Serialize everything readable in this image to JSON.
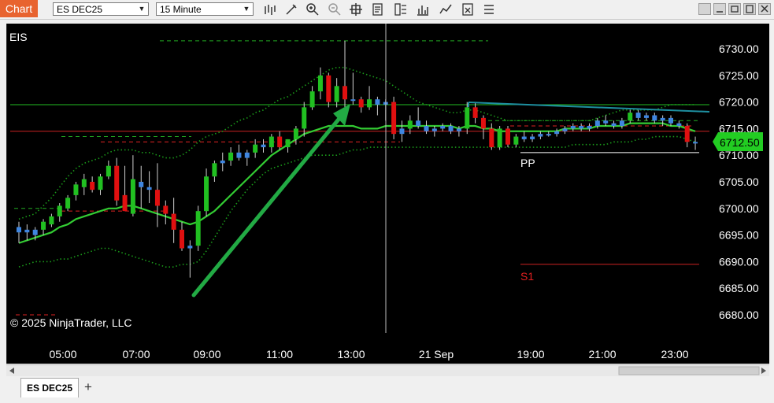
{
  "toolbar": {
    "chart_label": "Chart",
    "instrument_value": "ES DEC25",
    "interval_value": "15 Minute"
  },
  "chart": {
    "panel_label": "EIS",
    "copyright": "© 2025 NinjaTrader, LLC",
    "current_price": "6712.50",
    "pivot_labels": [
      "PP",
      "S1"
    ],
    "y_ticks": [
      "6730.00",
      "6725.00",
      "6720.00",
      "6715.00",
      "6710.00",
      "6705.00",
      "6700.00",
      "6695.00",
      "6690.00",
      "6685.00",
      "6680.00"
    ],
    "x_ticks": [
      "05:00",
      "07:00",
      "09:00",
      "11:00",
      "13:00",
      "21 Sep",
      "19:00",
      "21:00",
      "23:00"
    ],
    "colors": {
      "up": "#21c021",
      "down": "#e01010",
      "flat_up": "#3f86e0",
      "sma": "#33cc33",
      "band": "#1a9a1a",
      "price_tag": "#22cc22",
      "trend_arrow": "#22aa44"
    }
  },
  "chart_data": {
    "type": "candlestick",
    "y_range": [
      6678,
      6734
    ],
    "candles": [
      [
        6695.5,
        6697.5,
        6693.5,
        6696.5
      ],
      [
        6696.0,
        6697.0,
        6694.0,
        6695.5
      ],
      [
        6695.0,
        6696.5,
        6694.0,
        6696.0
      ],
      [
        6696.0,
        6698.0,
        6695.0,
        6697.5
      ],
      [
        6697.0,
        6699.0,
        6696.5,
        6698.5
      ],
      [
        6698.5,
        6701.0,
        6697.5,
        6700.5
      ],
      [
        6700.0,
        6702.5,
        6699.5,
        6702.0
      ],
      [
        6702.5,
        6705.0,
        6701.5,
        6704.5
      ],
      [
        6704.0,
        6706.5,
        6702.5,
        6705.5
      ],
      [
        6705.0,
        6706.0,
        6703.0,
        6703.5
      ],
      [
        6703.5,
        6706.5,
        6702.5,
        6706.0
      ],
      [
        6706.0,
        6709.0,
        6705.5,
        6708.0
      ],
      [
        6708.0,
        6709.5,
        6700.5,
        6701.5
      ],
      [
        6702.5,
        6708.0,
        6699.5,
        6699.5
      ],
      [
        6699.0,
        6710.0,
        6698.5,
        6705.5
      ],
      [
        6705.0,
        6708.0,
        6700.0,
        6704.0
      ],
      [
        6704.0,
        6707.0,
        6701.0,
        6703.5
      ],
      [
        6703.5,
        6708.5,
        6696.5,
        6700.5
      ],
      [
        6700.5,
        6701.5,
        6697.0,
        6699.0
      ],
      [
        6699.0,
        6702.0,
        6693.5,
        6696.0
      ],
      [
        6696.0,
        6697.5,
        6692.0,
        6692.5
      ],
      [
        6692.5,
        6694.0,
        6687.0,
        6693.0
      ],
      [
        6693.0,
        6700.5,
        6692.0,
        6699.5
      ],
      [
        6699.5,
        6707.5,
        6698.5,
        6706.0
      ],
      [
        6706.0,
        6709.0,
        6705.0,
        6708.5
      ],
      [
        6708.5,
        6710.5,
        6707.0,
        6709.0
      ],
      [
        6709.0,
        6711.5,
        6708.0,
        6710.5
      ],
      [
        6710.5,
        6712.0,
        6709.0,
        6709.5
      ],
      [
        6709.5,
        6711.0,
        6708.0,
        6710.5
      ],
      [
        6710.5,
        6713.0,
        6709.5,
        6712.0
      ],
      [
        6712.0,
        6713.0,
        6710.5,
        6711.5
      ],
      [
        6711.5,
        6714.0,
        6710.5,
        6713.5
      ],
      [
        6713.5,
        6714.5,
        6711.0,
        6711.5
      ],
      [
        6711.5,
        6713.0,
        6710.5,
        6713.0
      ],
      [
        6713.0,
        6715.5,
        6712.0,
        6715.0
      ],
      [
        6715.0,
        6720.0,
        6713.5,
        6719.0
      ],
      [
        6719.0,
        6723.0,
        6718.5,
        6722.0
      ],
      [
        6722.0,
        6726.5,
        6720.5,
        6725.0
      ],
      [
        6725.0,
        6725.5,
        6719.0,
        6720.0
      ],
      [
        6720.0,
        6724.5,
        6719.0,
        6723.0
      ],
      [
        6723.0,
        6731.5,
        6718.5,
        6720.5
      ],
      [
        6720.5,
        6725.5,
        6719.5,
        6720.5
      ],
      [
        6720.5,
        6721.0,
        6718.0,
        6719.0
      ],
      [
        6719.0,
        6723.0,
        6718.5,
        6720.5
      ],
      [
        6720.5,
        6721.0,
        6717.5,
        6719.5
      ],
      [
        6719.5,
        6720.5,
        6716.5,
        6720.0
      ],
      [
        6720.0,
        6721.0,
        6713.0,
        6714.0
      ],
      [
        6714.0,
        6716.5,
        6712.5,
        6715.0
      ],
      [
        6715.0,
        6717.5,
        6714.0,
        6716.5
      ],
      [
        6716.5,
        6719.0,
        6715.0,
        6715.5
      ],
      [
        6715.5,
        6716.5,
        6714.0,
        6714.5
      ],
      [
        6714.5,
        6715.5,
        6713.5,
        6715.0
      ],
      [
        6715.0,
        6716.0,
        6714.5,
        6715.5
      ],
      [
        6715.5,
        6716.0,
        6714.0,
        6714.5
      ],
      [
        6714.5,
        6715.5,
        6713.5,
        6715.0
      ],
      [
        6715.0,
        6720.0,
        6714.0,
        6719.0
      ],
      [
        6719.0,
        6720.0,
        6716.0,
        6717.0
      ],
      [
        6717.0,
        6717.5,
        6713.0,
        6715.0
      ],
      [
        6715.0,
        6716.0,
        6711.0,
        6711.5
      ],
      [
        6711.5,
        6715.5,
        6711.0,
        6715.0
      ],
      [
        6715.0,
        6715.5,
        6711.5,
        6712.0
      ],
      [
        6712.0,
        6714.0,
        6711.5,
        6713.5
      ],
      [
        6713.5,
        6714.5,
        6712.5,
        6713.0
      ],
      [
        6713.0,
        6714.0,
        6712.5,
        6713.5
      ],
      [
        6713.5,
        6714.5,
        6713.0,
        6714.0
      ],
      [
        6714.0,
        6714.5,
        6713.5,
        6714.0
      ],
      [
        6714.0,
        6715.0,
        6713.5,
        6714.5
      ],
      [
        6714.5,
        6715.5,
        6714.0,
        6715.0
      ],
      [
        6715.0,
        6716.0,
        6714.5,
        6715.5
      ],
      [
        6715.5,
        6716.0,
        6714.5,
        6715.0
      ],
      [
        6715.0,
        6716.0,
        6714.5,
        6715.5
      ],
      [
        6715.5,
        6717.0,
        6715.0,
        6716.5
      ],
      [
        6716.5,
        6717.5,
        6715.5,
        6716.0
      ],
      [
        6716.0,
        6716.5,
        6715.0,
        6715.5
      ],
      [
        6715.5,
        6717.0,
        6715.0,
        6716.5
      ],
      [
        6716.5,
        6718.5,
        6716.0,
        6718.0
      ],
      [
        6718.0,
        6718.5,
        6716.5,
        6717.0
      ],
      [
        6717.0,
        6718.0,
        6716.5,
        6717.5
      ],
      [
        6717.5,
        6718.0,
        6716.0,
        6716.5
      ],
      [
        6716.5,
        6717.5,
        6715.5,
        6717.0
      ],
      [
        6717.0,
        6717.5,
        6715.5,
        6716.0
      ],
      [
        6716.0,
        6716.5,
        6715.0,
        6715.5
      ],
      [
        6715.5,
        6716.0,
        6711.5,
        6712.5
      ],
      [
        6712.5,
        6713.5,
        6711.0,
        6712.5
      ]
    ],
    "sma": [
      6693.5,
      6694.0,
      6694.5,
      6695.0,
      6695.5,
      6696.5,
      6697.0,
      6698.0,
      6698.5,
      6699.0,
      6699.5,
      6700.0,
      6700.0,
      6700.5,
      6700.5,
      6700.0,
      6699.5,
      6699.0,
      6698.5,
      6698.0,
      6697.5,
      6697.0,
      6697.5,
      6698.5,
      6699.5,
      6701.0,
      6702.5,
      6704.0,
      6705.5,
      6707.0,
      6708.5,
      6710.0,
      6711.0,
      6712.0,
      6713.0,
      6714.0,
      6714.5,
      6715.0,
      6715.5,
      6715.5,
      6715.5,
      6715.5,
      6715.0,
      6715.0,
      6715.0,
      6715.5,
      6715.5,
      6715.5,
      6715.5,
      6715.5,
      6715.5,
      6715.5,
      6715.5,
      6715.5,
      6715.0,
      6715.5,
      6715.5,
      6715.0,
      6715.0,
      6714.5,
      6714.5,
      6714.5,
      6714.5,
      6714.5,
      6714.5,
      6714.5,
      6714.5,
      6715.0,
      6715.0,
      6715.0,
      6715.0,
      6715.5,
      6715.5,
      6715.5,
      6715.5,
      6716.0,
      6716.0,
      6716.0,
      6716.0,
      6716.0,
      6715.5,
      6715.5,
      6715.0,
      6714.5
    ],
    "band_upper": [
      6698.0,
      6698.5,
      6699.0,
      6700.5,
      6702.0,
      6704.0,
      6706.0,
      6707.5,
      6708.5,
      6709.0,
      6709.5,
      6710.5,
      6711.0,
      6711.0,
      6711.0,
      6710.5,
      6710.5,
      6710.0,
      6709.5,
      6709.5,
      6710.0,
      6711.0,
      6712.5,
      6713.5,
      6714.0,
      6714.5,
      6715.5,
      6716.5,
      6717.0,
      6718.0,
      6718.5,
      6719.5,
      6720.5,
      6721.0,
      6722.0,
      6723.0,
      6724.0,
      6725.0,
      6726.0,
      6726.5,
      6726.5,
      6726.0,
      6725.5,
      6725.0,
      6724.5,
      6724.0,
      6723.0,
      6722.0,
      6721.0,
      6720.0,
      6719.5,
      6719.0,
      6718.5,
      6718.0,
      6718.0,
      6718.5,
      6718.5,
      6718.0,
      6717.5,
      6717.0,
      6716.5,
      6716.5,
      6716.5,
      6716.5,
      6716.5,
      6716.5,
      6716.5,
      6716.5,
      6716.5,
      6716.5,
      6716.5,
      6717.0,
      6717.5,
      6718.0,
      6718.5,
      6718.5,
      6718.5,
      6718.5,
      6718.5,
      6719.0,
      6719.5,
      6719.5,
      6719.5,
      6719.5
    ],
    "band_lower": [
      6689.0,
      6689.5,
      6690.0,
      6690.0,
      6690.0,
      6690.5,
      6690.5,
      6691.0,
      6691.5,
      6692.0,
      6692.5,
      6692.5,
      6692.0,
      6691.5,
      6691.0,
      6690.5,
      6690.0,
      6689.5,
      6689.0,
      6689.0,
      6689.5,
      6689.5,
      6690.0,
      6692.0,
      6694.5,
      6697.0,
      6699.5,
      6701.5,
      6703.5,
      6705.0,
      6706.5,
      6707.5,
      6708.0,
      6708.5,
      6709.0,
      6709.5,
      6710.0,
      6710.0,
      6710.0,
      6710.0,
      6710.5,
      6711.0,
      6711.0,
      6711.5,
      6711.5,
      6711.5,
      6711.5,
      6711.5,
      6711.5,
      6711.5,
      6711.5,
      6711.5,
      6711.5,
      6711.5,
      6711.5,
      6711.5,
      6711.5,
      6711.5,
      6711.5,
      6711.5,
      6711.5,
      6711.5,
      6711.5,
      6711.5,
      6711.5,
      6711.5,
      6711.5,
      6711.5,
      6712.0,
      6712.0,
      6712.0,
      6712.0,
      6712.0,
      6712.5,
      6712.5,
      6712.5,
      6713.0,
      6713.0,
      6713.5,
      6713.5,
      6713.5,
      6713.5,
      6713.0,
      6712.5
    ],
    "levels": [
      {
        "value": 6719.5,
        "color": "#22bb22",
        "style": "solid"
      },
      {
        "value": 6714.5,
        "color": "#cc2222",
        "style": "solid"
      },
      {
        "value": 6731.5,
        "color": "#22aa22",
        "style": "dash"
      },
      {
        "value": 6713.5,
        "color": "#22aa22",
        "style": "dash"
      },
      {
        "value": 6712.5,
        "color": "#dd2222",
        "style": "dash"
      },
      {
        "value": 6710.5,
        "color": "#ffffff",
        "style": "solid"
      },
      {
        "value": 6689.5,
        "color": "#cc2222",
        "style": "solid"
      }
    ]
  }
}
